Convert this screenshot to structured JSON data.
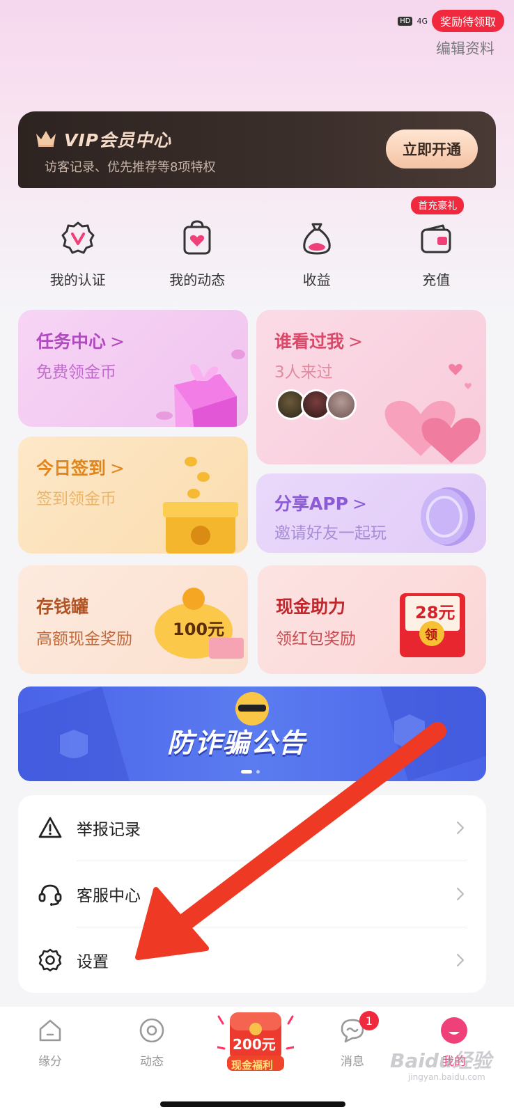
{
  "status": {
    "hd": "HD",
    "network": "4G",
    "reward_pill": "奖励待领取"
  },
  "header": {
    "edit_profile": "编辑资料"
  },
  "vip": {
    "title": "VIP会员中心",
    "subtitle": "访客记录、优先推荐等8项特权",
    "button": "立即开通"
  },
  "quick_actions": [
    {
      "label": "我的认证",
      "icon": "verify-shield-icon"
    },
    {
      "label": "我的动态",
      "icon": "heart-bag-icon"
    },
    {
      "label": "收益",
      "icon": "money-bag-icon"
    },
    {
      "label": "充值",
      "icon": "wallet-icon",
      "badge": "首充豪礼"
    }
  ],
  "cards": {
    "task": {
      "title": "任务中心",
      "subtitle": "免费领金币"
    },
    "visitors": {
      "title": "谁看过我",
      "subtitle": "3人来过"
    },
    "checkin": {
      "title": "今日签到",
      "subtitle": "签到领金币"
    },
    "share": {
      "title": "分享APP",
      "subtitle": "邀请好友一起玩"
    },
    "piggy": {
      "title": "存钱罐",
      "subtitle": "高额现金奖励",
      "amount": "100元"
    },
    "cash": {
      "title": "现金助力",
      "subtitle": "领红包奖励",
      "amount": "28元",
      "envelope_label": "领"
    }
  },
  "chevron": ">",
  "banner": {
    "text": "防诈骗公告"
  },
  "menu": [
    {
      "label": "举报记录",
      "icon": "warning-icon"
    },
    {
      "label": "客服中心",
      "icon": "headset-icon"
    },
    {
      "label": "设置",
      "icon": "gear-icon"
    }
  ],
  "tabbar": {
    "tabs": [
      {
        "label": "缘分",
        "icon": "home-icon"
      },
      {
        "label": "动态",
        "icon": "circle-dot-icon"
      },
      {
        "label": "现金福利",
        "icon": "red-envelope-icon",
        "amount": "200元"
      },
      {
        "label": "消息",
        "icon": "chat-icon",
        "badge": "1"
      },
      {
        "label": "我的",
        "icon": "profile-face-icon"
      }
    ]
  },
  "watermark": {
    "text": "Baidu经验",
    "sub": "jingyan.baidu.com"
  },
  "colors": {
    "accent_red": "#f0293e",
    "vip_gold": "#f6dcc8",
    "banner_blue": "#4a63e8",
    "annotation_arrow": "#ee3a24"
  }
}
